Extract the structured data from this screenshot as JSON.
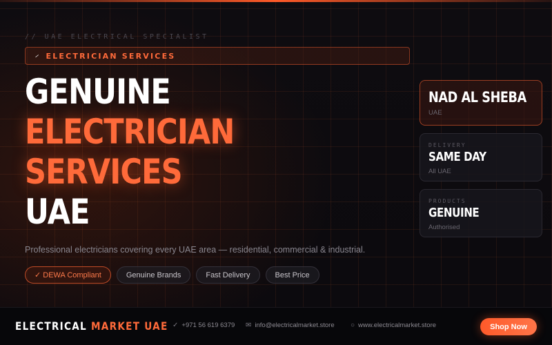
{
  "hero": {
    "kicker": "// UAE ELECTRICAL SPECIALIST",
    "badge": {
      "icon": "screwdriver-icon",
      "label": "ELECTRICIAN SERVICES"
    },
    "headline": {
      "line1": "GENUINE",
      "line2": "ELECTRICIAN",
      "line3": "SERVICES",
      "line4": "UAE"
    },
    "subtext": "Professional electricians covering every UAE area — residential, commercial & industrial.",
    "chips": [
      "✓ DEWA Compliant",
      "Genuine Brands",
      "Fast Delivery",
      "Best Price"
    ]
  },
  "cards": {
    "location": {
      "title": "NAD AL SHEBA",
      "sub": "UAE"
    },
    "delivery": {
      "caption": "DELIVERY",
      "title": "SAME DAY",
      "sub": "All UAE"
    },
    "products": {
      "caption": "PRODUCTS",
      "title": "GENUINE",
      "sub": "Authorised"
    }
  },
  "footer": {
    "brand_a": "ELECTRICAL",
    "brand_b": "MARKET UAE",
    "phone": "+971 56 619 6379",
    "email": "info@electricalmarket.store",
    "web": "www.electricalmarket.store",
    "cta": "Shop Now"
  },
  "colors": {
    "accent": "#ff6a3a",
    "background": "#0b0a0f"
  }
}
